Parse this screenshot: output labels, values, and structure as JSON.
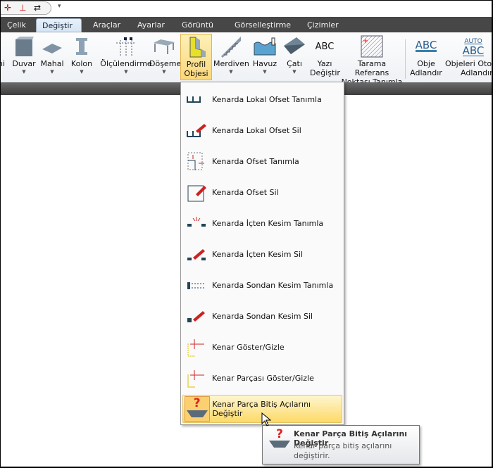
{
  "tabs": [
    "Çelik",
    "Değiştir",
    "Araçlar",
    "Ayarlar",
    "Görüntü",
    "Görselleştirme",
    "Çizimler"
  ],
  "active_tab": "Değiştir",
  "ribbon": [
    {
      "label": "ni",
      "icon": "wall-icon"
    },
    {
      "label": "Duvar",
      "icon": "wall-icon"
    },
    {
      "label": "Mahal",
      "icon": "room-icon"
    },
    {
      "label": "Kolon",
      "icon": "column-icon"
    },
    {
      "label": "Ölçülendirme",
      "icon": "dimension-icon"
    },
    {
      "label": "Döşeme",
      "icon": "slab-icon"
    },
    {
      "label": "Profil",
      "label2": "Objesi",
      "icon": "profile-icon"
    },
    {
      "label": "Merdiven",
      "icon": "stairs-icon"
    },
    {
      "label": "Havuz",
      "icon": "pool-icon"
    },
    {
      "label": "Çatı",
      "icon": "roof-icon"
    },
    {
      "label": "Yazı",
      "label2": "Değiştir",
      "icon": "text-icon",
      "glyph": "ABC"
    },
    {
      "label": "Tarama Referans",
      "label2": "Noktası Tanımla",
      "icon": "hatch-icon"
    },
    {
      "label": "Obje",
      "label2": "Adlandır",
      "icon": "name-object-icon",
      "glyph": "ABC"
    },
    {
      "label": "Objeleri Otom",
      "label2": "Adlandır",
      "icon": "auto-name-icon",
      "glyph": "ABC",
      "glyph_top": "AUTO"
    }
  ],
  "menu": [
    "Kenarda Lokal Ofset Tanımla",
    "Kenarda Lokal Ofset Sil",
    "Kenarda Ofset Tanımla",
    "Kenarda Ofset Sil",
    "Kenarda İçten Kesim Tanımla",
    "Kenarda İçten Kesim Sil",
    "Kenarda Sondan Kesim Tanımla",
    "Kenarda Sondan Kesim Sil",
    "Kenar Göster/Gizle",
    "Kenar Parçası Göster/Gizle",
    "Kenar Parça Bitiş Açılarını Değiştir"
  ],
  "tooltip": {
    "title": "Kenar Parça Bitiş Açılarını Değiştir",
    "desc": "Kenar parça bitiş açılarını değiştirir.",
    "icon_glyph": "?"
  },
  "colors": {
    "accent": "#fbd77a",
    "tabbar": "#474747"
  }
}
